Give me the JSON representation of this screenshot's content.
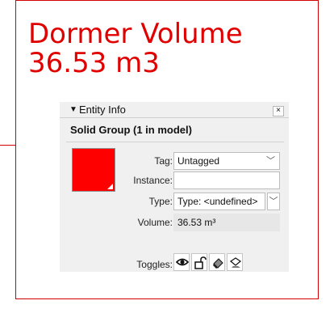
{
  "callout": {
    "title_line1": "Dormer Volume",
    "title_line2": "36.53 m3",
    "accent_color": "#e00000"
  },
  "panel": {
    "header": "Entity Info",
    "collapse_icon": "triangle-down-icon",
    "close_label": "×",
    "selection": "Solid Group (1 in model)",
    "material_color": "#ff0000",
    "fields": {
      "tag_label": "Tag:",
      "tag_value": "Untagged",
      "instance_label": "Instance:",
      "instance_value": "",
      "type_label": "Type:",
      "type_value": "Type: <undefined>",
      "volume_label": "Volume:",
      "volume_value": "36.53 m³",
      "toggles_label": "Toggles:"
    },
    "toggles": [
      "eye-icon",
      "lock-icon",
      "cast-shadows-icon",
      "receive-shadows-icon"
    ]
  }
}
